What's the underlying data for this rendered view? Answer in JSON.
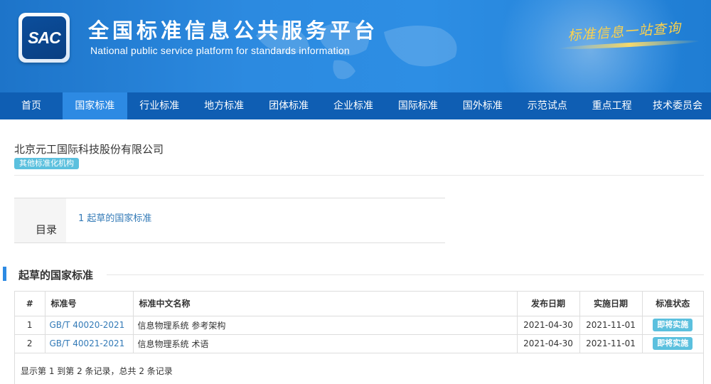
{
  "header": {
    "logo_text": "SAC",
    "title_cn": "全国标准信息公共服务平台",
    "title_en": "National public service platform  for standards information",
    "slogan": "标准信息一站查询"
  },
  "nav": {
    "items": [
      {
        "label": "首页"
      },
      {
        "label": "国家标准"
      },
      {
        "label": "行业标准"
      },
      {
        "label": "地方标准"
      },
      {
        "label": "团体标准"
      },
      {
        "label": "企业标准"
      },
      {
        "label": "国际标准"
      },
      {
        "label": "国外标准"
      },
      {
        "label": "示范试点"
      },
      {
        "label": "重点工程"
      },
      {
        "label": "技术委员会"
      }
    ],
    "active_index": 1
  },
  "org": {
    "name": "北京元工国际科技股份有限公司",
    "badge": "其他标准化机构"
  },
  "toc": {
    "label": "目录",
    "items": [
      {
        "label": "1  起草的国家标准"
      }
    ]
  },
  "section": {
    "title": "起草的国家标准"
  },
  "table": {
    "headers": [
      "#",
      "标准号",
      "标准中文名称",
      "发布日期",
      "实施日期",
      "标准状态"
    ],
    "rows": [
      {
        "idx": "1",
        "code": "GB/T 40020-2021",
        "name": "信息物理系统 参考架构",
        "publish_date": "2021-04-30",
        "effective_date": "2021-11-01",
        "status": "即将实施"
      },
      {
        "idx": "2",
        "code": "GB/T 40021-2021",
        "name": "信息物理系统 术语",
        "publish_date": "2021-04-30",
        "effective_date": "2021-11-01",
        "status": "即将实施"
      }
    ],
    "footer": "显示第 1 到第 2 条记录，总共 2 条记录"
  },
  "colors": {
    "banner": "#2c8ae0",
    "nav": "#0f5eb3",
    "nav_active": "#2d8ae3",
    "badge": "#5bc0de",
    "link": "#337ab7",
    "slogan": "#ffd24a"
  }
}
